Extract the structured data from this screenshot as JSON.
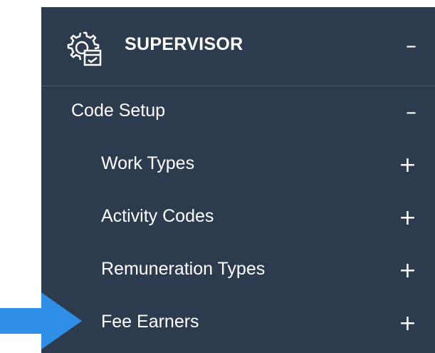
{
  "menu": {
    "header": {
      "title": "SUPERVISOR",
      "icon": "gear-checklist-icon",
      "toggle": "–"
    },
    "items": [
      {
        "label": "Code Setup",
        "level": 1,
        "toggle": "–"
      },
      {
        "label": "Work Types",
        "level": 2,
        "toggle": "+"
      },
      {
        "label": "Activity Codes",
        "level": 2,
        "toggle": "+"
      },
      {
        "label": "Remuneration Types",
        "level": 2,
        "toggle": "+"
      },
      {
        "label": "Fee Earners",
        "level": 2,
        "toggle": "+"
      }
    ]
  },
  "annotation": {
    "icon": "arrow-right-icon",
    "color": "#2f8fe6"
  },
  "colors": {
    "panel": "#2d3b4e",
    "text": "#ffffff",
    "divider": "#4a5a6e"
  }
}
